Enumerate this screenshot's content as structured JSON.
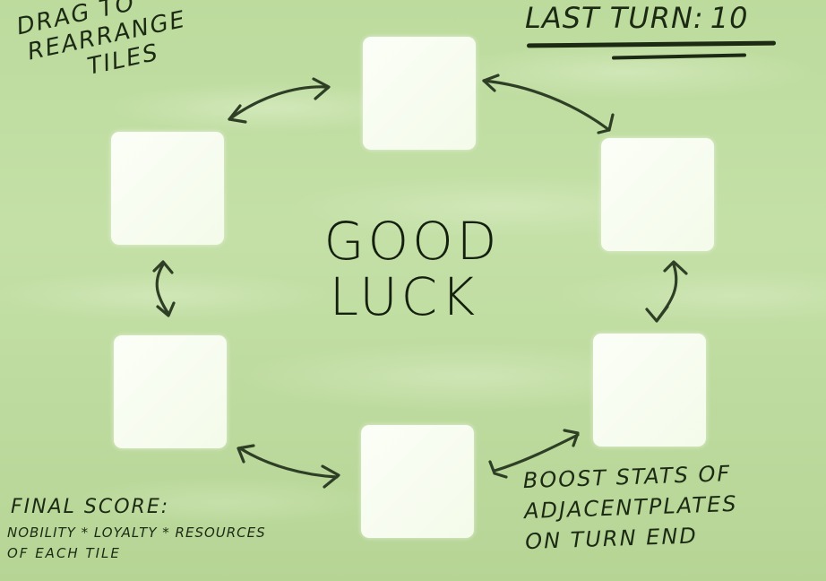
{
  "hud": {
    "last_turn_label": "LAST TURN:",
    "last_turn_value": "10"
  },
  "center_message": {
    "line1": "GOOD",
    "line2": "LUCK"
  },
  "hints": {
    "drag": [
      "DRAG TO",
      "REARRANGE",
      "TILES"
    ],
    "boost": [
      "BOOST STATS OF",
      "ADJACENTPLATES",
      "ON TURN END"
    ],
    "score": {
      "title": "FINAL SCORE:",
      "formula": "NOBILITY * LOYALTY * RESOURCES",
      "suffix": "OF EACH TILE"
    }
  },
  "tiles": [
    {
      "position": "top",
      "content": ""
    },
    {
      "position": "upper-right",
      "content": ""
    },
    {
      "position": "lower-right",
      "content": ""
    },
    {
      "position": "bottom",
      "content": ""
    },
    {
      "position": "lower-left",
      "content": ""
    },
    {
      "position": "upper-left",
      "content": ""
    }
  ],
  "arrows": [
    {
      "from": "upper-left",
      "to": "top",
      "icon": "double-arrow-icon"
    },
    {
      "from": "top",
      "to": "upper-right",
      "icon": "double-arrow-icon"
    },
    {
      "from": "upper-right",
      "to": "lower-right",
      "icon": "double-arrow-icon"
    },
    {
      "from": "lower-right",
      "to": "bottom",
      "icon": "double-arrow-icon"
    },
    {
      "from": "bottom",
      "to": "lower-left",
      "icon": "double-arrow-icon"
    },
    {
      "from": "lower-left",
      "to": "upper-left",
      "icon": "double-arrow-icon"
    }
  ],
  "colors": {
    "background": "#bcdb9d",
    "tile": "#f7fcef",
    "ink": "#1c2a14"
  }
}
